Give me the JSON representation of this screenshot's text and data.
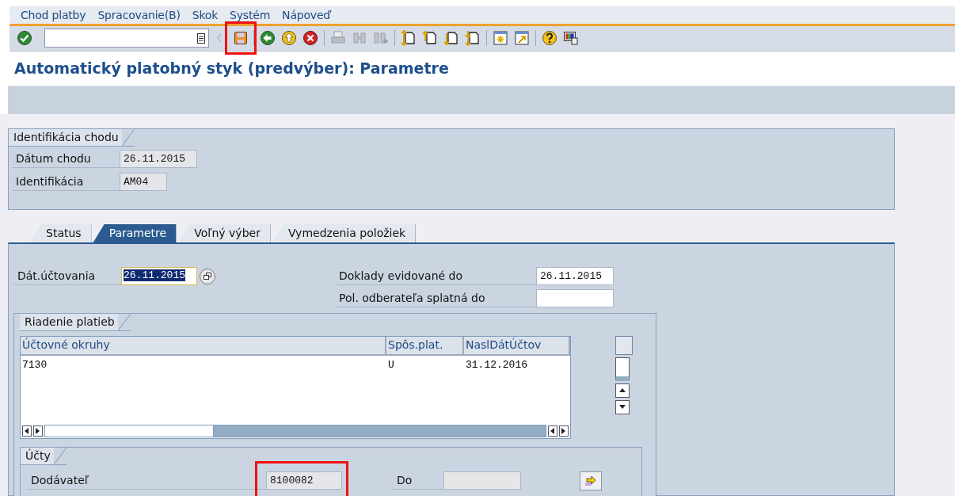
{
  "menu": [
    {
      "label": "Chod platby"
    },
    {
      "label": "Spracovanie(B)"
    },
    {
      "label": "Skok"
    },
    {
      "label": "Systém"
    },
    {
      "label": "Nápoveď"
    }
  ],
  "toolbar": {
    "groups": [
      [
        {
          "kind": "enter",
          "disabled": false,
          "highlighted": false
        }
      ],
      [
        {
          "kind": "save",
          "disabled": false,
          "highlighted": true
        }
      ],
      [
        {
          "kind": "back",
          "disabled": false,
          "highlighted": false
        },
        {
          "kind": "exit",
          "disabled": false,
          "highlighted": false
        },
        {
          "kind": "cancel",
          "disabled": false,
          "highlighted": false
        }
      ],
      [
        {
          "kind": "print",
          "disabled": true,
          "highlighted": false
        },
        {
          "kind": "find",
          "disabled": true,
          "highlighted": false
        },
        {
          "kind": "find-next",
          "disabled": true,
          "highlighted": false
        }
      ],
      [
        {
          "kind": "first-page",
          "disabled": false,
          "highlighted": false
        },
        {
          "kind": "prev-page",
          "disabled": false,
          "highlighted": false
        },
        {
          "kind": "next-page",
          "disabled": false,
          "highlighted": false
        },
        {
          "kind": "last-page",
          "disabled": false,
          "highlighted": false
        }
      ],
      [
        {
          "kind": "new-session",
          "disabled": false,
          "highlighted": false
        },
        {
          "kind": "shortcut",
          "disabled": false,
          "highlighted": false
        }
      ],
      [
        {
          "kind": "help",
          "disabled": false,
          "highlighted": false
        },
        {
          "kind": "layout",
          "disabled": false,
          "highlighted": false
        }
      ]
    ]
  },
  "title": "Automatický platobný styk (predvýber): Parametre",
  "identification": {
    "title": "Identifikácia chodu",
    "fields": [
      {
        "label": "Dátum chodu",
        "value": "26.11.2015"
      },
      {
        "label": "Identifikácia",
        "value": "AM04"
      }
    ]
  },
  "tabs": [
    {
      "label": "Status",
      "selected": false
    },
    {
      "label": "Parametre",
      "selected": true
    },
    {
      "label": "Voľný výber",
      "selected": false
    },
    {
      "label": "Vymedzenia položiek",
      "selected": false
    }
  ],
  "parameters": {
    "posting_date": {
      "label": "Dát.účtovania",
      "value": "26.11.2015",
      "focused": true
    },
    "documents_until": {
      "label": "Doklady evidované do",
      "value": "26.11.2015"
    },
    "customer_due_until": {
      "label": "Pol. odberateľa splatná do"
    }
  },
  "payment_control": {
    "title": "Riadenie platieb",
    "columns": [
      "Účtovné okruhy",
      "Spôs.plat.",
      "NaslDátÚčtov"
    ],
    "rows": [
      [
        "7130",
        "U",
        "31.12.2016"
      ]
    ]
  },
  "accounts": {
    "title": "Účty",
    "vendor": {
      "label": "Dodávateľ",
      "value": "8100082",
      "highlighted": true
    },
    "to": {
      "label": "Do",
      "disabled": true
    }
  }
}
